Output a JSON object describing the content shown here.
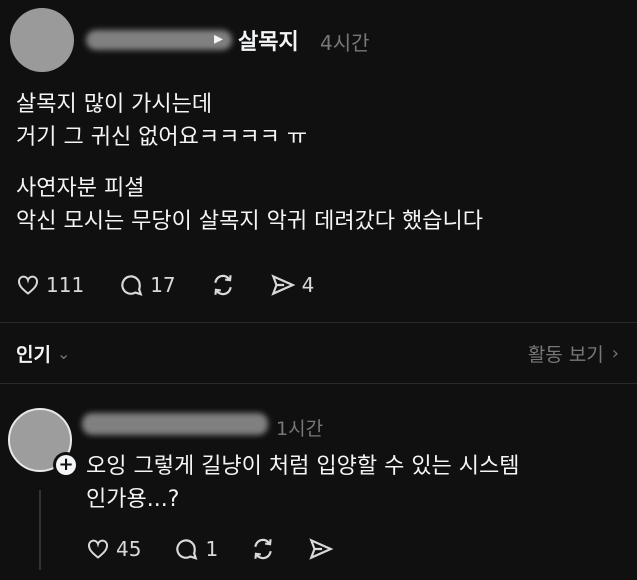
{
  "post": {
    "topic": "살목지",
    "time": "4시간",
    "lines_1": [
      "살목지 많이 가시는데",
      "거기 그 귀신 없어요ㅋㅋㅋㅋ ㅠ"
    ],
    "lines_2": [
      "사연자분 피셜",
      "악신 모시는 무당이 살목지 악귀 데려갔다 했습니다"
    ],
    "likes": "111",
    "comments": "17",
    "shares": "4"
  },
  "sort": {
    "label": "인기",
    "view_activity": "활동 보기"
  },
  "reply": {
    "time": "1시간",
    "lines": [
      "오잉 그렇게 길냥이 처럼 입양할 수 있는 시스템",
      "인가용...?"
    ],
    "likes": "45",
    "comments": "1"
  }
}
